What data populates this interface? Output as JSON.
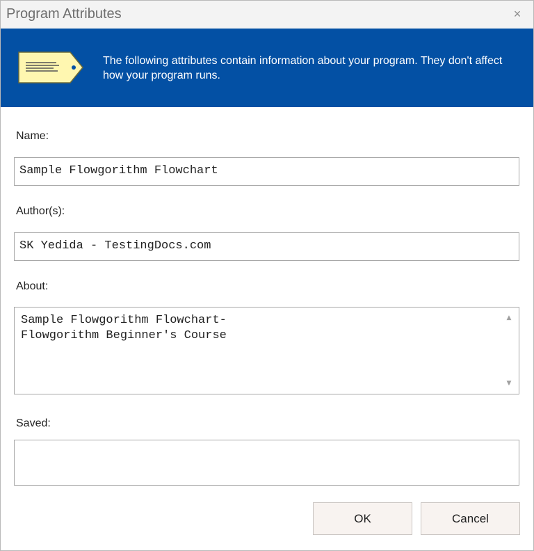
{
  "window": {
    "title": "Program Attributes",
    "close_glyph": "×"
  },
  "banner": {
    "icon": "tag-icon",
    "text": "The following attributes contain information about your program. They don't affect how your program runs.",
    "background": "#0350a4"
  },
  "fields": {
    "name": {
      "label": "Name:",
      "value": "Sample Flowgorithm Flowchart"
    },
    "authors": {
      "label": "Author(s):",
      "value": "SK Yedida - TestingDocs.com"
    },
    "about": {
      "label": "About:",
      "value": "Sample Flowgorithm Flowchart-\nFlowgorithm Beginner's Course"
    },
    "saved": {
      "label": "Saved:",
      "value": ""
    }
  },
  "buttons": {
    "ok": "OK",
    "cancel": "Cancel"
  }
}
